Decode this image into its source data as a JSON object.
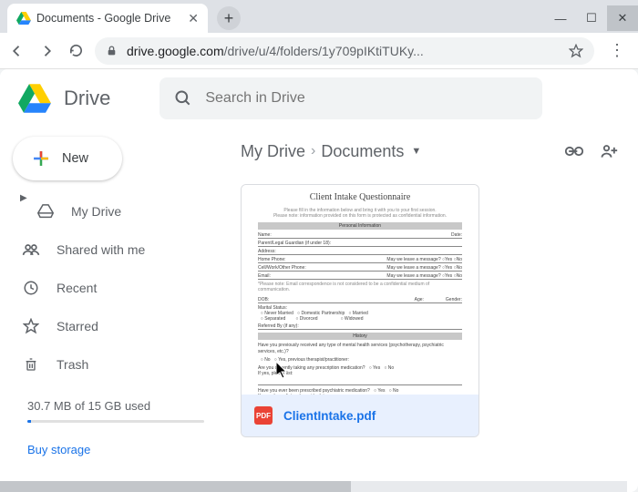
{
  "browser": {
    "tab_title": "Documents - Google Drive",
    "url_host": "drive.google.com",
    "url_path": "/drive/u/4/folders/1y709pIKtiTUKy..."
  },
  "header": {
    "app_name": "Drive",
    "search_placeholder": "Search in Drive"
  },
  "sidebar": {
    "new_label": "New",
    "items": [
      {
        "label": "My Drive"
      },
      {
        "label": "Shared with me"
      },
      {
        "label": "Recent"
      },
      {
        "label": "Starred"
      },
      {
        "label": "Trash"
      }
    ],
    "storage_text": "30.7 MB of 15 GB used",
    "buy_storage": "Buy storage"
  },
  "breadcrumb": {
    "root": "My Drive",
    "leaf": "Documents"
  },
  "files": [
    {
      "name": "ClientIntake.pdf",
      "badge": "PDF",
      "preview_title": "Client Intake Questionnaire",
      "preview_section1": "Personal Information",
      "preview_section2": "History"
    }
  ]
}
